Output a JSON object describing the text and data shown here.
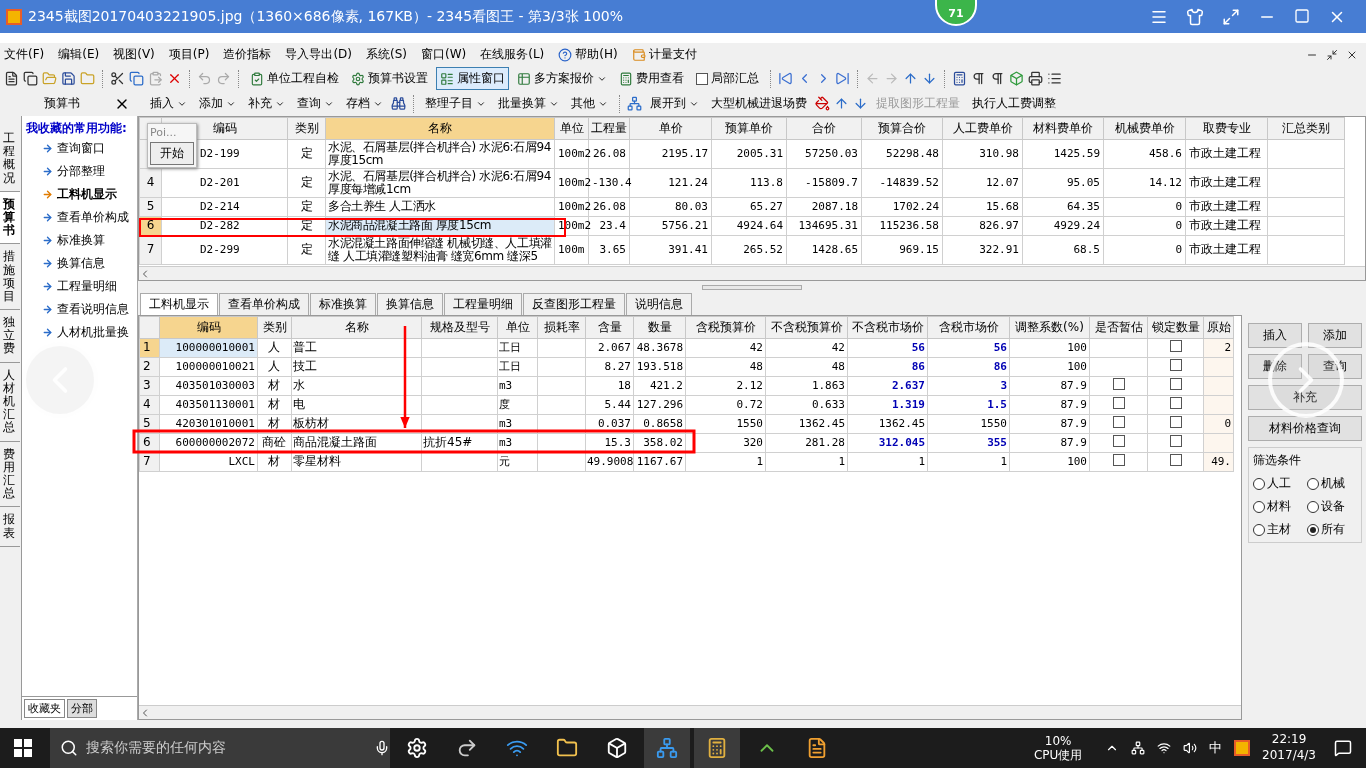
{
  "viewer": {
    "title": "2345截图20170403221905.jpg（1360×686像素, 167KB）- 2345看图王 - 第3/3张 100%",
    "badge": "71"
  },
  "menu": [
    "文件(F)",
    "编辑(E)",
    "视图(V)",
    "项目(P)",
    "造价指标",
    "导入导出(D)",
    "系统(S)",
    "窗口(W)",
    "在线服务(L)",
    "帮助(H)",
    "计量支付"
  ],
  "toolbar": [
    {
      "label": "单位工程自检",
      "kind": "button",
      "selected": false
    },
    {
      "label": "预算书设置",
      "kind": "button",
      "selected": false
    },
    {
      "label": "属性窗口",
      "kind": "button",
      "selected": true
    },
    {
      "label": "多方案报价",
      "kind": "dropdown",
      "selected": false
    },
    {
      "label": "费用查看",
      "kind": "button",
      "selected": false
    },
    {
      "label": "局部汇总",
      "kind": "checkbox",
      "selected": false
    }
  ],
  "toolbar2": [
    {
      "label": "插入",
      "dropdown": true,
      "disabled": false
    },
    {
      "label": "添加",
      "dropdown": true,
      "disabled": false
    },
    {
      "label": "补充",
      "dropdown": true,
      "disabled": false
    },
    {
      "label": "查询",
      "dropdown": true,
      "disabled": false
    },
    {
      "label": "存档",
      "dropdown": true,
      "disabled": false
    },
    {
      "label": "整理子目",
      "dropdown": true,
      "disabled": false
    },
    {
      "label": "批量换算",
      "dropdown": true,
      "disabled": false
    },
    {
      "label": "其他",
      "dropdown": true,
      "disabled": false
    },
    {
      "label": "展开到",
      "dropdown": true,
      "disabled": false
    },
    {
      "label": "大型机械进退场费",
      "dropdown": false,
      "disabled": false
    },
    {
      "label": "提取图形工程量",
      "dropdown": false,
      "disabled": true
    },
    {
      "label": "执行人工费调整",
      "dropdown": false,
      "disabled": false
    }
  ],
  "side_tabs": [
    {
      "label": "工程概况",
      "selected": false
    },
    {
      "label": "预算书",
      "selected": true
    },
    {
      "label": "措施项目",
      "selected": false
    },
    {
      "label": "独立费",
      "selected": false
    },
    {
      "label": "人材机汇总",
      "selected": false
    },
    {
      "label": "费用汇总",
      "selected": false
    },
    {
      "label": "报表",
      "selected": false
    }
  ],
  "sidebar": {
    "title": "预算书",
    "heading": "我收藏的常用功能:",
    "items": [
      {
        "label": "查询窗口",
        "active": false
      },
      {
        "label": "分部整理",
        "active": false
      },
      {
        "label": "工料机显示",
        "active": true
      },
      {
        "label": "查看单价构成",
        "active": false
      },
      {
        "label": "标准换算",
        "active": false
      },
      {
        "label": "换算信息",
        "active": false
      },
      {
        "label": "工程量明细",
        "active": false
      },
      {
        "label": "查看说明信息",
        "active": false
      },
      {
        "label": "人材机批量换",
        "active": false
      }
    ],
    "bottom_tabs": [
      {
        "label": "收藏夹",
        "selected": true
      },
      {
        "label": "分部",
        "selected": false
      }
    ]
  },
  "popup": {
    "title": "Poi...",
    "button": "开始"
  },
  "top_table": {
    "columns": [
      "编码",
      "类别",
      "名称",
      "单位",
      "工程量",
      "单价",
      "预算单价",
      "合价",
      "预算合价",
      "人工费单价",
      "材料费单价",
      "机械费单价",
      "取费专业",
      "汇总类别"
    ],
    "rows": [
      {
        "code": "D2-199",
        "type": "定",
        "name": "水泥、石屑基层(拌合机拌合) 水泥6:石屑94 厚度15cm",
        "unit": "100m2",
        "qty": "26.08",
        "price": "2195.17",
        "budget_price": "2005.31",
        "total": "57250.03",
        "budget_total": "52298.48",
        "labor": "310.98",
        "material": "1425.59",
        "machine": "458.6",
        "fee": "市政土建工程",
        "selected": false
      },
      {
        "num": "4",
        "code": "D2-201",
        "type": "定",
        "name": "水泥、石屑基层(拌合机拌合) 水泥6:石屑94 厚度每增减1cm",
        "unit": "100m2",
        "qty": "-130.4",
        "price": "121.24",
        "budget_price": "113.8",
        "total": "-15809.7",
        "budget_total": "-14839.52",
        "labor": "12.07",
        "material": "95.05",
        "machine": "14.12",
        "fee": "市政土建工程",
        "selected": false
      },
      {
        "num": "5",
        "code": "D2-214",
        "type": "定",
        "name": "多合土养生 人工洒水",
        "unit": "100m2",
        "qty": "26.08",
        "price": "80.03",
        "budget_price": "65.27",
        "total": "2087.18",
        "budget_total": "1702.24",
        "labor": "15.68",
        "material": "64.35",
        "machine": "0",
        "fee": "市政土建工程",
        "selected": false
      },
      {
        "num": "6",
        "code": "D2-282",
        "type": "定",
        "name": "水泥商品混凝土路面 厚度15cm",
        "unit": "100m2",
        "qty": "23.4",
        "price": "5756.21",
        "budget_price": "4924.64",
        "total": "134695.31",
        "budget_total": "115236.58",
        "labor": "826.97",
        "material": "4929.24",
        "machine": "0",
        "fee": "市政土建工程",
        "selected": true
      },
      {
        "num": "7",
        "code": "D2-299",
        "type": "定",
        "name": "水泥混凝土路面伸缩缝 机械切缝、人工填灌缝 人工填灌缝塑料油膏 缝宽6mm 缝深5",
        "unit": "100m",
        "qty": "3.65",
        "price": "391.41",
        "budget_price": "265.52",
        "total": "1428.65",
        "budget_total": "969.15",
        "labor": "322.91",
        "material": "68.5",
        "machine": "0",
        "fee": "市政土建工程",
        "selected": false
      }
    ]
  },
  "bottom_tabs": [
    {
      "label": "工料机显示",
      "selected": true
    },
    {
      "label": "查看单价构成",
      "selected": false
    },
    {
      "label": "标准换算",
      "selected": false
    },
    {
      "label": "换算信息",
      "selected": false
    },
    {
      "label": "工程量明细",
      "selected": false
    },
    {
      "label": "反查图形工程量",
      "selected": false
    },
    {
      "label": "说明信息",
      "selected": false
    }
  ],
  "bottom_table": {
    "columns": [
      "编码",
      "类别",
      "名称",
      "规格及型号",
      "单位",
      "损耗率",
      "含量",
      "数量",
      "含税预算价",
      "不含税预算价",
      "不含税市场价",
      "含税市场价",
      "调整系数(%)",
      "是否暂估",
      "锁定数量",
      "原始"
    ],
    "rows": [
      {
        "num": "1",
        "code": "100000010001",
        "type": "人",
        "name": "普工",
        "unit": "工日",
        "content": "2.067",
        "quantity": "48.3678",
        "tax_budget": "42",
        "notax_budget": "42",
        "notax_market": "56",
        "tax_market": "56",
        "price_adjusted": true,
        "coef": "100",
        "locked": false,
        "original": "2",
        "selected": true
      },
      {
        "num": "2",
        "code": "100000010021",
        "type": "人",
        "name": "技工",
        "unit": "工日",
        "content": "8.27",
        "quantity": "193.518",
        "tax_budget": "48",
        "notax_budget": "48",
        "notax_market": "86",
        "tax_market": "86",
        "price_adjusted": true,
        "coef": "100",
        "locked": false,
        "selected": false
      },
      {
        "num": "3",
        "code": "403501030003",
        "type": "材",
        "name": "水",
        "unit": "m3",
        "content": "18",
        "quantity": "421.2",
        "tax_budget": "2.12",
        "notax_budget": "1.863",
        "notax_market": "2.637",
        "tax_market": "3",
        "price_adjusted": true,
        "coef": "87.9",
        "estimate": false,
        "locked": false,
        "selected": false
      },
      {
        "num": "4",
        "code": "403501130001",
        "type": "材",
        "name": "电",
        "unit": "度",
        "content": "5.44",
        "quantity": "127.296",
        "tax_budget": "0.72",
        "notax_budget": "0.633",
        "notax_market": "1.319",
        "tax_market": "1.5",
        "price_adjusted": true,
        "coef": "87.9",
        "estimate": false,
        "locked": false,
        "selected": false
      },
      {
        "num": "5",
        "code": "420301010001",
        "type": "材",
        "name": "板枋材",
        "unit": "m3",
        "content": "0.037",
        "quantity": "0.8658",
        "tax_budget": "1550",
        "notax_budget": "1362.45",
        "notax_market": "1362.45",
        "tax_market": "1550",
        "price_adjusted": false,
        "coef": "87.9",
        "estimate": false,
        "locked": false,
        "original": "0",
        "selected": false
      },
      {
        "num": "6",
        "code": "600000002072",
        "type": "商砼",
        "name": "商品混凝土路面",
        "spec": "抗折45#",
        "unit": "m3",
        "content": "15.3",
        "quantity": "358.02",
        "tax_budget": "320",
        "notax_budget": "281.28",
        "notax_market": "312.045",
        "tax_market": "355",
        "price_adjusted": true,
        "coef": "87.9",
        "estimate": false,
        "locked": false,
        "selected": false
      },
      {
        "num": "7",
        "code": "LXCL",
        "type": "材",
        "name": "零星材料",
        "unit": "元",
        "content": "49.9008",
        "quantity": "1167.67",
        "tax_budget": "1",
        "notax_budget": "1",
        "notax_market": "1",
        "tax_market": "1",
        "price_adjusted": false,
        "coef": "100",
        "estimate": false,
        "locked": false,
        "original": "49.",
        "selected": false
      }
    ]
  },
  "right_panel": {
    "buttons": [
      "插入",
      "添加",
      "删除",
      "查询",
      "补充",
      "材料价格查询"
    ],
    "filter": {
      "title": "筛选条件",
      "options": [
        {
          "label": "人工",
          "selected": false
        },
        {
          "label": "机械",
          "selected": false
        },
        {
          "label": "材料",
          "selected": false
        },
        {
          "label": "设备",
          "selected": false
        },
        {
          "label": "主材",
          "selected": false
        },
        {
          "label": "所有",
          "selected": true
        }
      ]
    }
  },
  "taskbar": {
    "search_placeholder": "搜索你需要的任何内容",
    "cpu": "10%",
    "cpu_label": "CPU使用",
    "ime": "中",
    "time": "22:19",
    "date": "2017/4/3"
  }
}
